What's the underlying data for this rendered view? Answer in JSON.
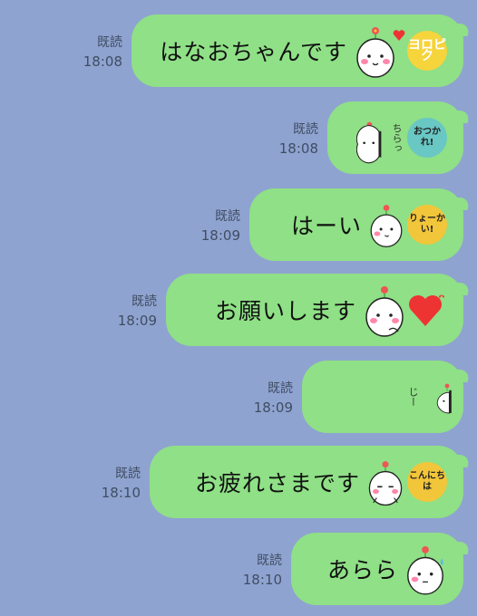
{
  "messages": [
    {
      "read": "既読",
      "time": "18:08",
      "text": "はなおちゃんです",
      "stamp": "ヨロピク"
    },
    {
      "read": "既読",
      "time": "18:08",
      "text": "",
      "side": "ちらっ",
      "stamp": "おつかれ!"
    },
    {
      "read": "既読",
      "time": "18:09",
      "text": "はーい",
      "stamp": "りょーかい!"
    },
    {
      "read": "既読",
      "time": "18:09",
      "text": "お願いします",
      "stamp": "heart"
    },
    {
      "read": "既読",
      "time": "18:09",
      "text": "",
      "side": "じー",
      "stamp": ""
    },
    {
      "read": "既読",
      "time": "18:10",
      "text": "お疲れさまです",
      "stamp": "こんにちは"
    },
    {
      "read": "既読",
      "time": "18:10",
      "text": "あらら",
      "stamp": ""
    }
  ],
  "colors": {
    "background": "#8fa3d0",
    "bubble": "#8fe086"
  }
}
